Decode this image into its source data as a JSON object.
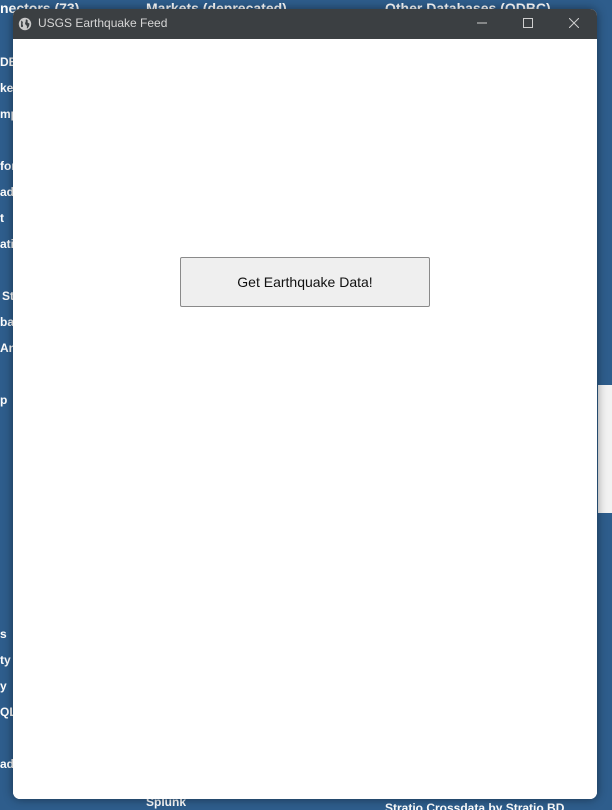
{
  "background": {
    "heading_left": "nectors (73)",
    "heading_mid": "Markets (deprecated)",
    "heading_right": "Other Databases (ODBC)",
    "left_fragments": [
      "DB",
      "ke",
      "mpl",
      "for",
      "ado",
      "t",
      "ati",
      "St",
      "bas",
      "Ana",
      "p",
      "s",
      "ty (",
      "y",
      "QL",
      "ado"
    ],
    "bottom_mid": "Splunk",
    "bottom_right": "Stratio Crossdata by Stratio BD"
  },
  "window": {
    "title": "USGS Earthquake Feed",
    "minimize_icon": "minimize-icon",
    "maximize_icon": "maximize-icon",
    "close_icon": "close-icon",
    "app_icon": "globe-icon"
  },
  "main": {
    "button_label": "Get Earthquake Data!"
  }
}
